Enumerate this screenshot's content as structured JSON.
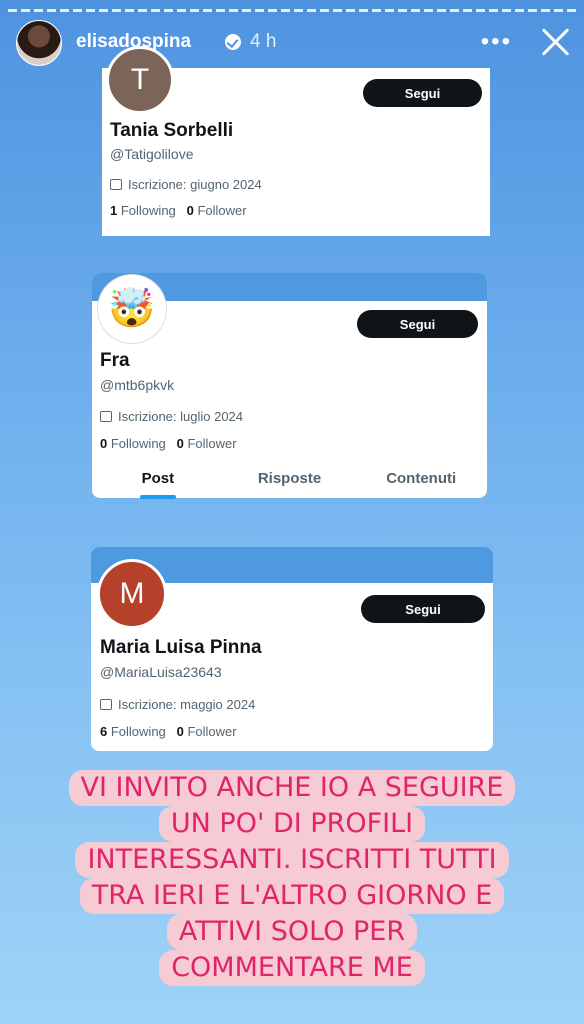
{
  "story": {
    "username": "elisadospina",
    "time": "4 h"
  },
  "cards": [
    {
      "initial": "T",
      "follow_label": "Segui",
      "name": "Tania Sorbelli",
      "handle": "@Tatigolilove",
      "joined": "Iscrizione: giugno 2024",
      "following_count": "1",
      "following_label": "Following",
      "follower_count": "0",
      "follower_label": "Follower"
    },
    {
      "emoji": "🤯",
      "follow_label": "Segui",
      "name": "Fra",
      "handle": "@mtb6pkvk",
      "joined": "Iscrizione: luglio 2024",
      "following_count": "0",
      "following_label": "Following",
      "follower_count": "0",
      "follower_label": "Follower",
      "tabs": [
        "Post",
        "Risposte",
        "Contenuti"
      ]
    },
    {
      "initial": "M",
      "follow_label": "Segui",
      "name": "Maria Luisa Pinna",
      "handle": "@MariaLuisa23643",
      "joined": "Iscrizione: maggio 2024",
      "following_count": "6",
      "following_label": "Following",
      "follower_count": "0",
      "follower_label": "Follower"
    }
  ],
  "caption_lines": [
    "VI INVITO ANCHE IO A SEGUIRE",
    "UN PO' DI PROFILI",
    "INTERESSANTI. ISCRITTI TUTTI",
    "TRA IERI E L'ALTRO GIORNO E",
    "ATTIVI SOLO PER",
    "COMMENTARE ME"
  ],
  "colors": {
    "banner": "#4f99e0",
    "caption_bg": "#f7cbd3",
    "caption_text": "#e0246a",
    "pfp_t": "#7a6558",
    "pfp_m": "#b5412a"
  }
}
